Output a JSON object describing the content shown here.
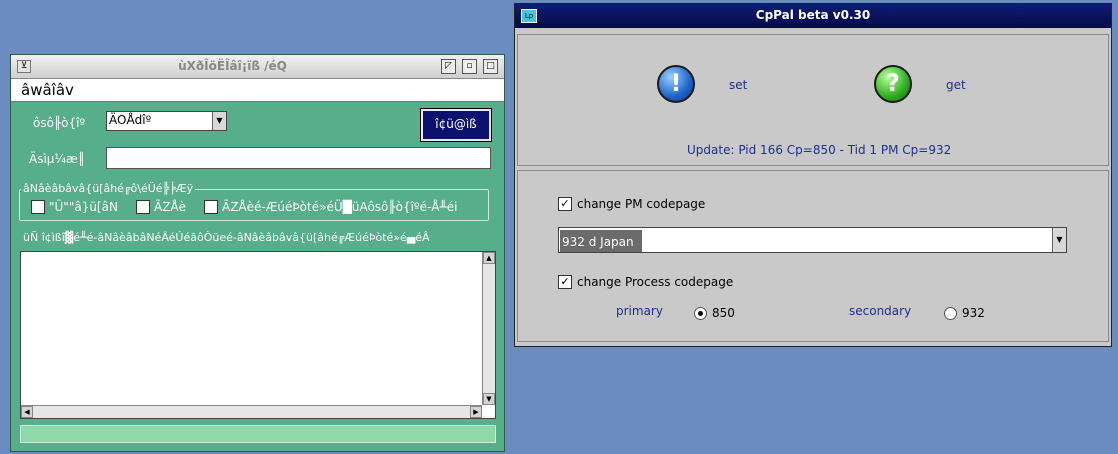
{
  "left_window": {
    "title": "ùXðÎöËÎâî¡ïß /éQ",
    "sys_menu_glyph": "⊻",
    "win_buttons": [
      "◸",
      "▫",
      "□"
    ],
    "menu": "âwâîâv",
    "field1_label": "ôsô╟ò{îº",
    "field1_value": "ÄOÅdîº",
    "action_button": "î¢ü@ìß",
    "field2_label": "Äsìµ¼æ║",
    "group_legend": "âNâèâbâvâ{ü[âhé╔ô\\éÜé╠╞Æÿ",
    "checkboxes": [
      {
        "label": "\"Ü\"\"â}ü[âN",
        "checked": false
      },
      {
        "label": "ÃZÅè",
        "checked": false
      },
      {
        "label": "ÃZÅèé-ÆúéÞòté»éÜ█üAôsô╟ò{îºé-Å╨éi",
        "checked": false
      }
    ],
    "description": "üÑ î¢ìßî▓é╨é-âNâèâbâNéÄéÚéãôÒüeé-âNâèâbâvâ{ü[âhé╔ÆúéÞòté»é▄éÂ"
  },
  "right_window": {
    "title": "CpPal beta v0.30",
    "sys_icon_text": "Lp",
    "set_label": "set",
    "get_label": "get",
    "set_icon_glyph": "!",
    "get_icon_glyph": "?",
    "update_text": "Update:  Pid 166  Cp=850 - Tid 1  PM Cp=932",
    "change_pm_label": "change PM codepage",
    "change_pm_checked": true,
    "pm_codepage_value": "932  d  Japan",
    "change_process_label": "change Process codepage",
    "change_process_checked": true,
    "primary_label": "primary",
    "primary_value": "850",
    "secondary_label": "secondary",
    "secondary_value": "932"
  },
  "colors": {
    "desktop": "#6b8cbe",
    "left_window_bg": "#57ae8a",
    "right_window_bg": "#c9c9c9",
    "titlebar_active": "#0f1c72",
    "label_blue": "#1e2f8c"
  }
}
